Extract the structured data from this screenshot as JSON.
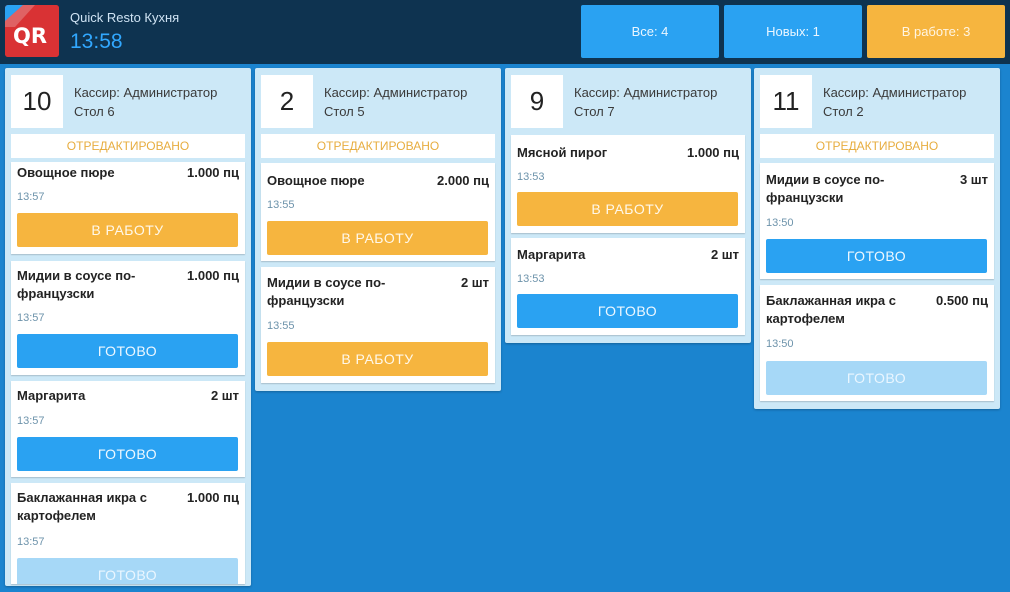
{
  "header": {
    "app_title": "Quick Resto Кухня",
    "clock": "13:58",
    "logo_text": "QR",
    "filters": {
      "all": "Все: 4",
      "new": "Новых: 1",
      "in_work": "В работе: 3"
    }
  },
  "colors": {
    "background": "#1b84cf",
    "topbar": "#0e3350",
    "ready_button": "#2aa2f2",
    "work_button": "#f6b53f",
    "edited_text": "#e7ad3f"
  },
  "columns": [
    {
      "number": "10",
      "cashier": "Кассир: Администратор",
      "table": "Стол 6",
      "edited": "ОТРЕДАКТИРОВАНО",
      "items": [
        {
          "dish": "Овощное пюре",
          "qty": "1.000 пц",
          "time": "13:57",
          "action": "В РАБОТУ"
        },
        {
          "dish": "Мидии в соусе по-французски",
          "qty": "1.000 пц",
          "time": "13:57",
          "action": "ГОТОВО"
        },
        {
          "dish": "Маргарита",
          "qty": "2 шт",
          "time": "13:57",
          "action": "ГОТОВО"
        },
        {
          "dish": "Баклажанная икра с картофелем",
          "qty": "1.000 пц",
          "time": "13:57",
          "action": "ГОТОВО"
        }
      ]
    },
    {
      "number": "2",
      "cashier": "Кассир: Администратор",
      "table": "Стол 5",
      "edited": "ОТРЕДАКТИРОВАНО",
      "items": [
        {
          "dish": "Овощное пюре",
          "qty": "2.000 пц",
          "time": "13:55",
          "action": "В РАБОТУ"
        },
        {
          "dish": "Мидии в соусе по-французски",
          "qty": "2 шт",
          "time": "13:55",
          "action": "В РАБОТУ"
        }
      ]
    },
    {
      "number": "9",
      "cashier": "Кассир: Администратор",
      "table": "Стол 7",
      "items": [
        {
          "dish": "Мясной пирог",
          "qty": "1.000 пц",
          "time": "13:53",
          "action": "В РАБОТУ"
        },
        {
          "dish": "Маргарита",
          "qty": "2 шт",
          "time": "13:53",
          "action": "ГОТОВО"
        }
      ]
    },
    {
      "number": "11",
      "cashier": "Кассир: Администратор",
      "table": "Стол 2",
      "edited": "ОТРЕДАКТИРОВАНО",
      "items": [
        {
          "dish": "Мидии в соусе по-французски",
          "qty": "3 шт",
          "time": "13:50",
          "action": "ГОТОВО"
        },
        {
          "dish": "Баклажанная икра с картофелем",
          "qty": "0.500 пц",
          "time": "13:50",
          "action": "ГОТОВО"
        }
      ]
    }
  ]
}
